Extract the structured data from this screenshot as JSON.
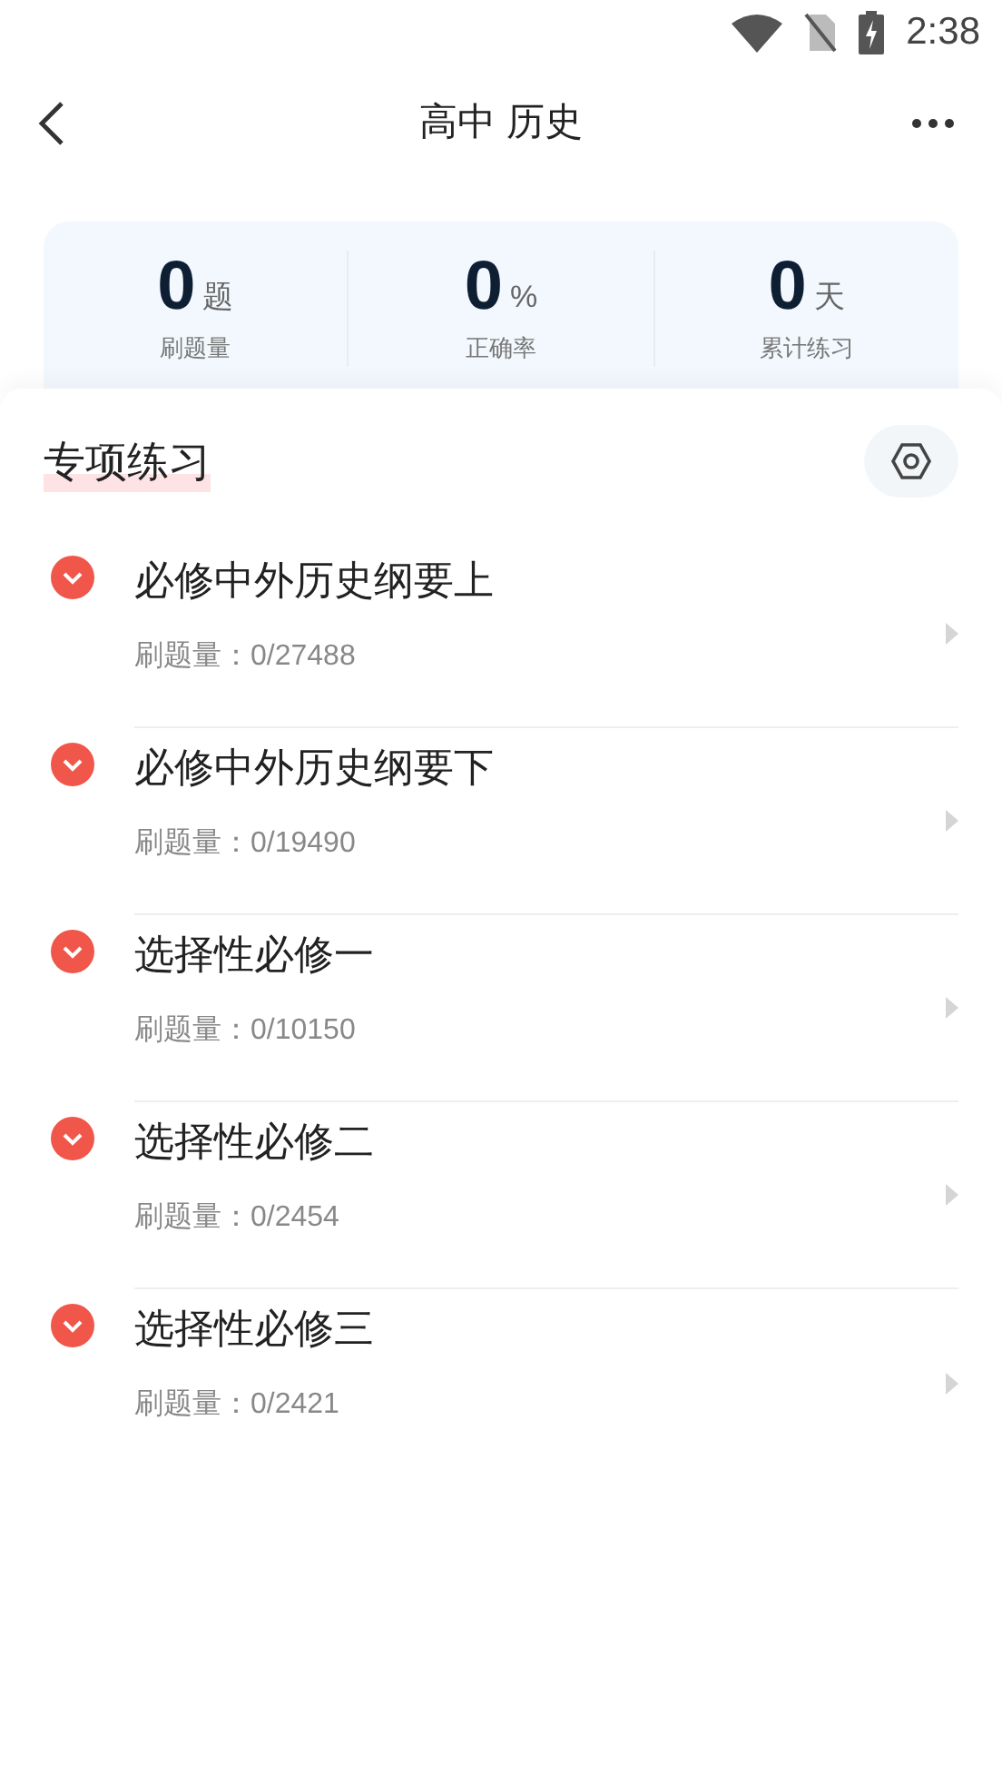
{
  "status_bar": {
    "time": "2:38"
  },
  "header": {
    "title": "高中 历史"
  },
  "stats": [
    {
      "value": "0",
      "unit": "题",
      "label": "刷题量"
    },
    {
      "value": "0",
      "unit": "%",
      "label": "正确率"
    },
    {
      "value": "0",
      "unit": "天",
      "label": "累计练习"
    }
  ],
  "section": {
    "title": "专项练习"
  },
  "items": [
    {
      "title": "必修中外历史纲要上",
      "progress": "刷题量：0/27488"
    },
    {
      "title": "必修中外历史纲要下",
      "progress": "刷题量：0/19490"
    },
    {
      "title": "选择性必修一",
      "progress": "刷题量：0/10150"
    },
    {
      "title": "选择性必修二",
      "progress": "刷题量：0/2454"
    },
    {
      "title": "选择性必修三",
      "progress": "刷题量：0/2421"
    }
  ]
}
